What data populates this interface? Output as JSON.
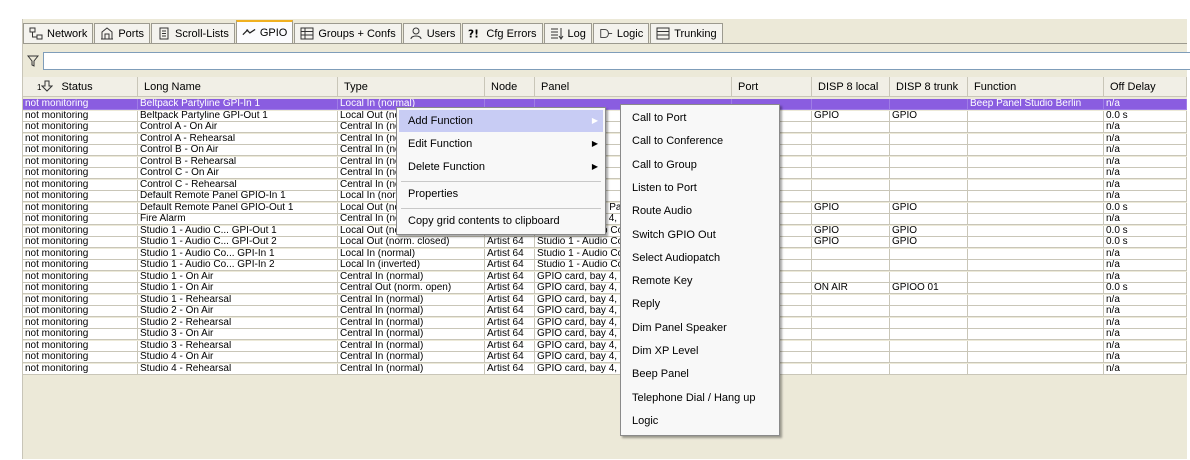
{
  "tabs": [
    {
      "label": "Network",
      "icon": "network-icon"
    },
    {
      "label": "Ports",
      "icon": "ports-icon"
    },
    {
      "label": "Scroll-Lists",
      "icon": "scroll-list-icon"
    },
    {
      "label": "GPIO",
      "icon": "gpio-icon",
      "active": true
    },
    {
      "label": "Groups + Confs",
      "icon": "groups-icon"
    },
    {
      "label": "Users",
      "icon": "users-icon"
    },
    {
      "label": "Cfg Errors",
      "icon": "cfg-errors-icon"
    },
    {
      "label": "Log",
      "icon": "log-icon"
    },
    {
      "label": "Logic",
      "icon": "logic-icon"
    },
    {
      "label": "Trunking",
      "icon": "trunking-icon"
    }
  ],
  "filter": {
    "value": "",
    "icon": "filter-icon"
  },
  "columns": [
    "Status",
    "Long Name",
    "Type",
    "Node",
    "Panel",
    "Port",
    "DISP 8 local",
    "DISP 8 trunk",
    "Function",
    "Off Delay"
  ],
  "sort_column_index": 0,
  "sort_indicator": "1",
  "rows": [
    [
      "not monitoring",
      "Beltpack Partyline GPI-In 1",
      "Local In (normal)",
      "",
      "",
      "",
      "",
      "",
      "Beep Panel Studio Berlin",
      "n/a"
    ],
    [
      "not monitoring",
      "Beltpack Partyline GPI-Out 1",
      "Local Out (norm. open)",
      "",
      "",
      "",
      "GPIO",
      "GPIO",
      "",
      "0.0 s"
    ],
    [
      "not monitoring",
      "Control A - On Air",
      "Central In (normal)",
      "",
      "",
      "",
      "",
      "",
      "",
      "n/a"
    ],
    [
      "not monitoring",
      "Control A - Rehearsal",
      "Central In (normal)",
      "",
      "",
      "",
      "",
      "",
      "",
      "n/a"
    ],
    [
      "not monitoring",
      "Control B - On Air",
      "Central In (normal)",
      "",
      "",
      "",
      "",
      "",
      "",
      "n/a"
    ],
    [
      "not monitoring",
      "Control B - Rehearsal",
      "Central In (normal)",
      "",
      "",
      "",
      "",
      "",
      "",
      "n/a"
    ],
    [
      "not monitoring",
      "Control C - On Air",
      "Central In (normal)",
      "",
      "",
      "",
      "",
      "",
      "",
      "n/a"
    ],
    [
      "not monitoring",
      "Control C - Rehearsal",
      "Central In (normal)",
      "",
      "",
      "",
      "",
      "",
      "",
      "n/a"
    ],
    [
      "not monitoring",
      "Default Remote Panel GPIO-In 1",
      "Local In (normal)",
      "",
      "",
      "",
      "",
      "",
      "",
      "n/a"
    ],
    [
      "not monitoring",
      "Default Remote Panel GPIO-Out 1",
      "Local Out (norm. open)",
      "Artist 64",
      "Default Remote Panel",
      "",
      "GPIO",
      "GPIO",
      "",
      "0.0 s"
    ],
    [
      "not monitoring",
      "Fire Alarm",
      "Central In (normal)",
      "Artist 64",
      "GPIO card, bay 4, node 'Artist 64'",
      "",
      "",
      "",
      "",
      "n/a"
    ],
    [
      "not monitoring",
      "Studio 1 - Audio C... GPI-Out 1",
      "Local Out (norm. open)",
      "Artist 64",
      "Studio 1 - Audio Control",
      "",
      "GPIO",
      "GPIO",
      "",
      "0.0 s"
    ],
    [
      "not monitoring",
      "Studio 1 - Audio C... GPI-Out 2",
      "Local Out (norm. closed)",
      "Artist 64",
      "Studio 1 - Audio Control",
      "",
      "GPIO",
      "GPIO",
      "",
      "0.0 s"
    ],
    [
      "not monitoring",
      "Studio 1 - Audio Co... GPI-In 1",
      "Local In (normal)",
      "Artist 64",
      "Studio 1 - Audio Control",
      "",
      "",
      "",
      "",
      "n/a"
    ],
    [
      "not monitoring",
      "Studio 1 - Audio Co... GPI-In 2",
      "Local In (inverted)",
      "Artist 64",
      "Studio 1 - Audio Control",
      "",
      "",
      "",
      "",
      "n/a"
    ],
    [
      "not monitoring",
      "Studio 1 - On Air",
      "Central In (normal)",
      "Artist 64",
      "GPIO card, bay 4, node 'Artist 64'",
      "",
      "",
      "",
      "",
      "n/a"
    ],
    [
      "not monitoring",
      "Studio 1 - On Air",
      "Central Out (norm. open)",
      "Artist 64",
      "GPIO card, bay 4, node 'Artist 64'",
      "",
      "ON AIR",
      "GPIOO 01",
      "",
      "0.0 s"
    ],
    [
      "not monitoring",
      "Studio 1 - Rehearsal",
      "Central In (normal)",
      "Artist 64",
      "GPIO card, bay 4, node 'Artist 64'",
      "",
      "",
      "",
      "",
      "n/a"
    ],
    [
      "not monitoring",
      "Studio 2 - On Air",
      "Central In (normal)",
      "Artist 64",
      "GPIO card, bay 4, node 'Artist 64'",
      "",
      "",
      "",
      "",
      "n/a"
    ],
    [
      "not monitoring",
      "Studio 2 - Rehearsal",
      "Central In (normal)",
      "Artist 64",
      "GPIO card, bay 4, node 'Artist 64'",
      "",
      "",
      "",
      "",
      "n/a"
    ],
    [
      "not monitoring",
      "Studio 3 - On Air",
      "Central In (normal)",
      "Artist 64",
      "GPIO card, bay 4, node 'Artist 64'",
      "",
      "",
      "",
      "",
      "n/a"
    ],
    [
      "not monitoring",
      "Studio 3 - Rehearsal",
      "Central In (normal)",
      "Artist 64",
      "GPIO card, bay 4, node 'Artist 64'",
      "",
      "",
      "",
      "",
      "n/a"
    ],
    [
      "not monitoring",
      "Studio 4 - On Air",
      "Central In (normal)",
      "Artist 64",
      "GPIO card, bay 4, node 'Artist 64'",
      "4. 4",
      "",
      "",
      "",
      "n/a"
    ],
    [
      "not monitoring",
      "Studio 4 - Rehearsal",
      "Central In (normal)",
      "Artist 64",
      "GPIO card, bay 4, node 'Artist 64'",
      "4. 8",
      "",
      "",
      "",
      "n/a"
    ]
  ],
  "selected_row": 0,
  "context_menu": {
    "items": [
      {
        "label": "Add Function",
        "submenu": true,
        "highlighted": true
      },
      {
        "label": "Edit Function",
        "submenu": true
      },
      {
        "label": "Delete Function",
        "submenu": true
      },
      {
        "separator": true
      },
      {
        "label": "Properties"
      },
      {
        "separator": true
      },
      {
        "label": "Copy grid contents to clipboard"
      }
    ]
  },
  "submenu": {
    "items": [
      "Call to Port",
      "Call to Conference",
      "Call to Group",
      "Listen to Port",
      "Route Audio",
      "Switch GPIO Out",
      "Select Audiopatch",
      "Remote Key",
      "Reply",
      "Dim Panel Speaker",
      "Dim XP Level",
      "Beep Panel",
      "Telephone Dial / Hang up",
      "Logic"
    ]
  },
  "colors": {
    "selection": "#8a5de0",
    "menu_highlight": "#c8ccf4",
    "active_tab_accent": "#f0b020"
  }
}
